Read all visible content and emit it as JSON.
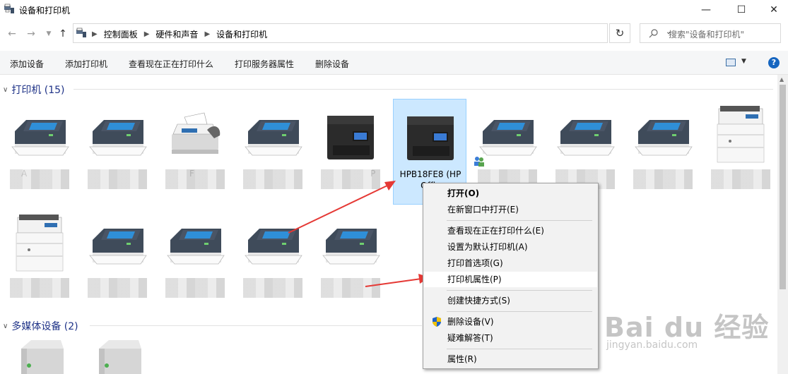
{
  "window": {
    "title": "设备和打印机",
    "controls": [
      "minimize",
      "maximize",
      "close"
    ]
  },
  "address_bar": {
    "crumbs": [
      "控制面板",
      "硬件和声音",
      "设备和打印机"
    ]
  },
  "search": {
    "placeholder": "搜索\"设备和打印机\""
  },
  "toolbar": {
    "add_device": "添加设备",
    "add_printer": "添加打印机",
    "see_printing": "查看现在正在打印什么",
    "print_server": "打印服务器属性",
    "remove_device": "删除设备"
  },
  "groups": {
    "printers": {
      "label": "打印机 (15)"
    },
    "media": {
      "label": "多媒体设备 (2)"
    }
  },
  "printers": [
    {
      "label": "A",
      "icon": "printer-icon"
    },
    {
      "label": "",
      "icon": "printer-icon"
    },
    {
      "label": "F",
      "icon": "fax-icon"
    },
    {
      "label": "",
      "icon": "printer-icon"
    },
    {
      "label": "P",
      "icon": "inkjet-printer-icon"
    },
    {
      "label": "HPB18FE8 (HP Offic 8",
      "icon": "inkjet-printer-icon",
      "selected": true
    },
    {
      "label": "",
      "icon": "printer-icon"
    },
    {
      "label": "",
      "icon": "printer-icon"
    },
    {
      "label": "",
      "icon": "printer-icon"
    },
    {
      "label": "",
      "icon": "laser-mfp-icon"
    },
    {
      "label": "",
      "icon": "laser-mfp-icon"
    },
    {
      "label": "",
      "icon": "printer-icon"
    },
    {
      "label": "",
      "icon": "printer-icon"
    },
    {
      "label": "",
      "icon": "printer-icon"
    },
    {
      "label": "",
      "icon": "printer-icon"
    }
  ],
  "selected_label_lines": [
    "HPB18FE8 (HP",
    "Offic",
    "8"
  ],
  "context_menu": {
    "items": [
      {
        "label": "打开(O)",
        "bold": true
      },
      {
        "label": "在新窗口中打开(E)"
      },
      {
        "label": "查看现在正在打印什么(E)"
      },
      {
        "label": "设置为默认打印机(A)"
      },
      {
        "label": "打印首选项(G)"
      },
      {
        "label": "打印机属性(P)",
        "highlighted": true
      },
      {
        "label": "创建快捷方式(S)"
      },
      {
        "label": "删除设备(V)",
        "icon": "shield-icon"
      },
      {
        "label": "疑难解答(T)"
      },
      {
        "label": "属性(R)"
      }
    ]
  },
  "annotation_colors": {
    "arrow": "#e53935",
    "accent": "#1565c0"
  },
  "watermark": {
    "brand": "Bai du 经验",
    "url": "jingyan.baidu.com"
  }
}
